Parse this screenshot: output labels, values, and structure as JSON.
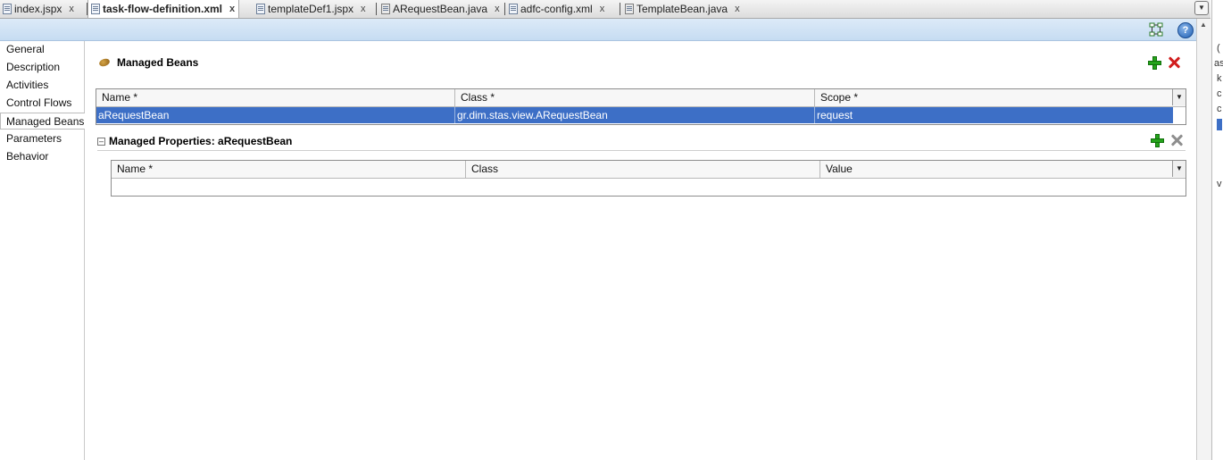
{
  "tabs": [
    {
      "label": "index.jspx",
      "close": "x"
    },
    {
      "label": "task-flow-definition.xml",
      "close": "x"
    },
    {
      "label": "templateDef1.jspx",
      "close": "x"
    },
    {
      "label": "ARequestBean.java",
      "close": "x"
    },
    {
      "label": "adfc-config.xml",
      "close": "x"
    },
    {
      "label": "TemplateBean.java",
      "close": "x"
    }
  ],
  "toolbar": {
    "help_label": "?"
  },
  "nav": {
    "items": [
      "General",
      "Description",
      "Activities",
      "Control Flows",
      "Managed Beans",
      "Parameters",
      "Behavior"
    ],
    "selected": "Managed Beans"
  },
  "managed_beans": {
    "title": "Managed Beans",
    "columns": [
      "Name *",
      "Class *",
      "Scope *"
    ],
    "rows": [
      {
        "name": "aRequestBean",
        "class": "gr.dim.stas.view.ARequestBean",
        "scope": "request"
      }
    ]
  },
  "managed_properties": {
    "title": "Managed Properties: aRequestBean",
    "collapse_glyph": "–",
    "columns": [
      "Name *",
      "Class",
      "Value"
    ]
  },
  "right_panel_fragments": [
    "(",
    "as",
    "k",
    "c",
    "c",
    "v"
  ],
  "colors": {
    "selection": "#3d6fc6",
    "band": "#c6dcf2",
    "add_green": "#25a31b",
    "delete_red": "#d11d1d"
  }
}
